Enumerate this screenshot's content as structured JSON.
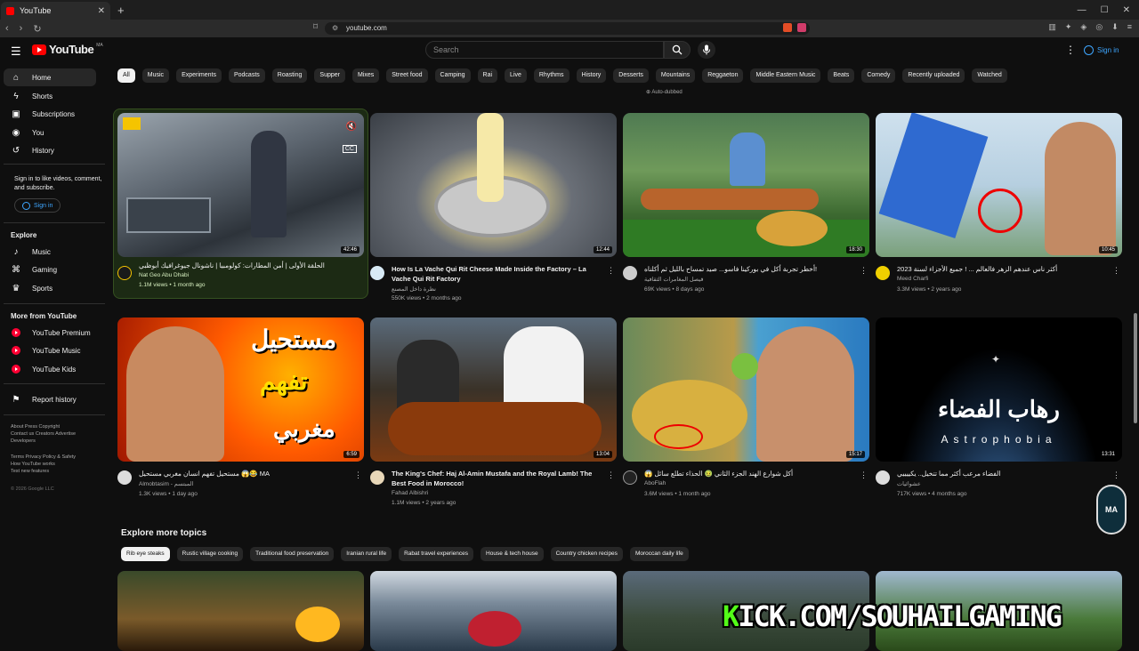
{
  "browser": {
    "tab_title": "YouTube",
    "url": "youtube.com"
  },
  "header": {
    "logo_text": "YouTube",
    "country_code": "MA",
    "search_placeholder": "Search",
    "sign_in": "Sign in"
  },
  "sidebar": {
    "items": [
      {
        "label": "Home",
        "icon": "home-icon"
      },
      {
        "label": "Shorts",
        "icon": "shorts-icon"
      },
      {
        "label": "Subscriptions",
        "icon": "subscriptions-icon"
      },
      {
        "label": "You",
        "icon": "you-icon"
      },
      {
        "label": "History",
        "icon": "history-icon"
      }
    ],
    "signin_note": "Sign in to like videos, comment, and subscribe.",
    "signin_button": "Sign in",
    "explore_heading": "Explore",
    "explore": [
      {
        "label": "Music",
        "icon": "music-icon"
      },
      {
        "label": "Gaming",
        "icon": "gaming-icon"
      },
      {
        "label": "Sports",
        "icon": "trophy-icon"
      }
    ],
    "more_heading": "More from YouTube",
    "more": [
      {
        "label": "YouTube Premium"
      },
      {
        "label": "YouTube Music"
      },
      {
        "label": "YouTube Kids"
      }
    ],
    "report": "Report history",
    "footer1": "About  Press  Copyright",
    "footer2": "Contact us  Creators  Advertise",
    "footer3": "Developers",
    "footer4": "Terms  Privacy  Policy & Safety",
    "footer5": "How YouTube works",
    "footer6": "Test new features",
    "copyright": "© 2026 Google LLC"
  },
  "chips": [
    "All",
    "Music",
    "Experiments",
    "Podcasts",
    "Roasting",
    "Supper",
    "Mixes",
    "Street food",
    "Camping",
    "Rai",
    "Live",
    "Rhythms",
    "History",
    "Desserts",
    "Mountains",
    "Reggaeton",
    "Middle Eastern Music",
    "Beats",
    "Comedy",
    "Recently uploaded",
    "Watched"
  ],
  "auto_dubbed": "Auto-dubbed",
  "videos": [
    {
      "title": "الحلقة الأولى | أمن المطارات: كولومبيا | ناشونال جيوغرافيك أبوظبي",
      "channel": "Nat Geo Abu Dhabi",
      "stats": "1.1M views • 1 month ago",
      "duration": "42:46"
    },
    {
      "title": "How Is La Vache Qui Rit Cheese Made Inside the Factory – La Vache Qui Rit Factory",
      "channel": "نظرة داخل المصنع",
      "stats": "550K views • 2 months ago",
      "duration": "12:44"
    },
    {
      "title": "أخطر تجربة أكل في بوركينا فاسو... صيد تمساح بالليل ثم أكلناه!",
      "channel": "فيصل المغامرات الثقافية",
      "stats": "69K views • 8 days ago",
      "duration": "18:30"
    },
    {
      "title": "أكثر ناس عندهم الزهر فالعالم ... ! جميع الأجزاء لسنة 2023",
      "channel": "Meed Charfi",
      "stats": "3.3M views • 2 years ago",
      "duration": "10:45"
    },
    {
      "title": "مستحيل تفهم انسان مغربي مستحيل 😱😂 MA",
      "channel": "Almobtasim - المبتسم",
      "stats": "1.3K views • 1 day ago",
      "duration": "6:59"
    },
    {
      "title": "The King's Chef: Haj Al-Amin Mustafa and the Royal Lamb! The Best Food in Morocco!",
      "channel": "Fahad Albishri",
      "stats": "1.1M views • 2 years ago",
      "duration": "13:04"
    },
    {
      "title": "😱 أكل شوارع الهند الجزء الثاني 🤢 الحذاء تطلع سائل",
      "channel": "AboFlah",
      "stats": "3.6M views • 1 month ago",
      "duration": "15:17"
    },
    {
      "title": "الفضاء مرعب أكثر مما تتخيل.. يكييييي",
      "channel": "عشوائيات",
      "stats": "717K views • 4 months ago",
      "duration": "13:31"
    }
  ],
  "thumb_texts": {
    "arabic_impossible_1": "مستحيل",
    "arabic_impossible_2": "تفهم",
    "arabic_impossible_3": "مغربي",
    "space_arabic": "رهاب الفضاء",
    "space_latin": "Astrophobia"
  },
  "explore_topics": {
    "title": "Explore more topics",
    "chips": [
      "Rib eye steaks",
      "Rustic village cooking",
      "Traditional food preservation",
      "Iranian rural life",
      "Rabat travel experiences",
      "House & tech house",
      "Country chicken recipes",
      "Moroccan daily life"
    ]
  },
  "overlay": {
    "kick_k": "K",
    "kick_rest": "ICK.COM/SOUHAILGAMING",
    "badge": "MA"
  }
}
